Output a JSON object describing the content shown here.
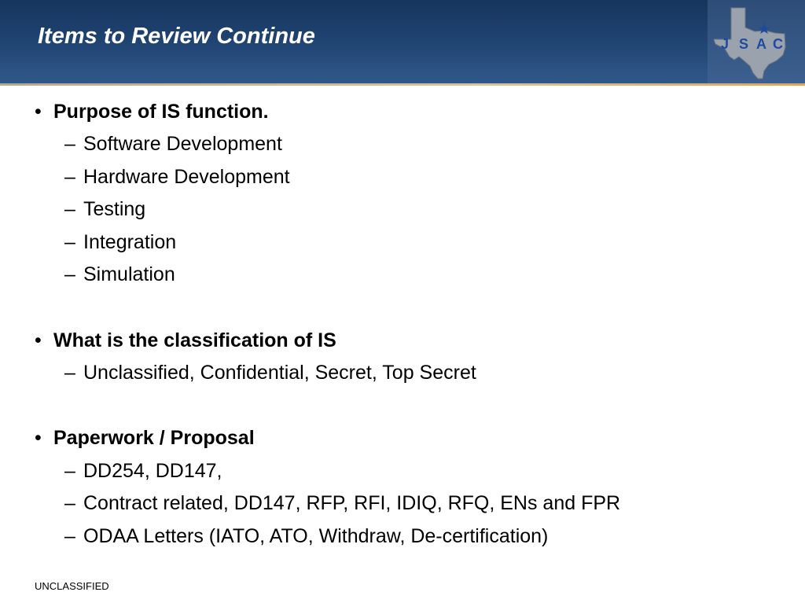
{
  "slide": {
    "title": "Items to Review Continue",
    "logo_letters": [
      "J",
      "S",
      "A",
      "C"
    ],
    "footer": "UNCLASSIFIED"
  },
  "outline": {
    "b1": {
      "text": "Purpose of IS function.",
      "subs": [
        "Software Development",
        "Hardware Development",
        "Testing",
        "Integration",
        "Simulation"
      ]
    },
    "b2": {
      "text": "What is the classification of IS",
      "subs": [
        "Unclassified, Confidential, Secret, Top Secret"
      ]
    },
    "b3": {
      "text": "Paperwork / Proposal",
      "subs": [
        "DD254, DD147,",
        "Contract related, DD147, RFP, RFI, IDIQ, RFQ, ENs and FPR",
        "ODAA Letters (IATO, ATO, Withdraw, De-certification)"
      ]
    }
  },
  "markers": {
    "bullet": "•",
    "dash": "–"
  },
  "colors": {
    "header": "#1f4270",
    "accent_rule": "#d8c29a",
    "logo_map": "#9aa3ad",
    "logo_text": "#1f4aa0"
  }
}
